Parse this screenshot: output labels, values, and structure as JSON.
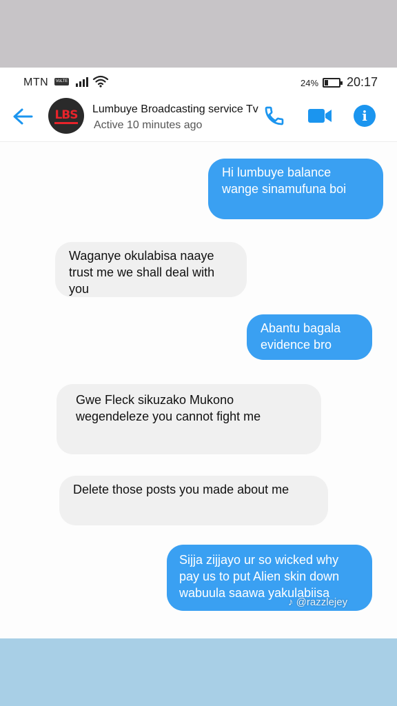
{
  "status_bar": {
    "carrier": "MTN",
    "volte": "VoLTE",
    "battery_percent": "24%",
    "battery_level": 0.24,
    "time": "20:17"
  },
  "header": {
    "contact_name": "Lumbuye Broadcasting service Tv",
    "contact_status": "Active 10 minutes ago",
    "avatar_logo": "LBS"
  },
  "messages": [
    {
      "direction": "outgoing",
      "text": "Hi lumbuye balance wange sinamufuna boi"
    },
    {
      "direction": "incoming",
      "text": "Waganye okulabisa naaye trust me we shall deal with you"
    },
    {
      "direction": "outgoing",
      "text": "Abantu bagala evidence bro"
    },
    {
      "direction": "incoming",
      "text": "Gwe Fleck sikuzako Mukono wegendeleze you cannot fight me"
    },
    {
      "direction": "incoming",
      "text": "Delete those posts you made about me"
    },
    {
      "direction": "outgoing",
      "text": "Sijja zijjayo ur so wicked why pay us to put Alien skin down wabuula saawa yakulabiisa"
    }
  ],
  "watermark": "♪ @razzlejey",
  "colors": {
    "accent": "#1b95ef",
    "outgoing_bubble": "#3aa0f2",
    "incoming_bubble": "#f0f0f0",
    "top_band": "#c7c4c7",
    "bottom_band": "#a8cfe6"
  }
}
